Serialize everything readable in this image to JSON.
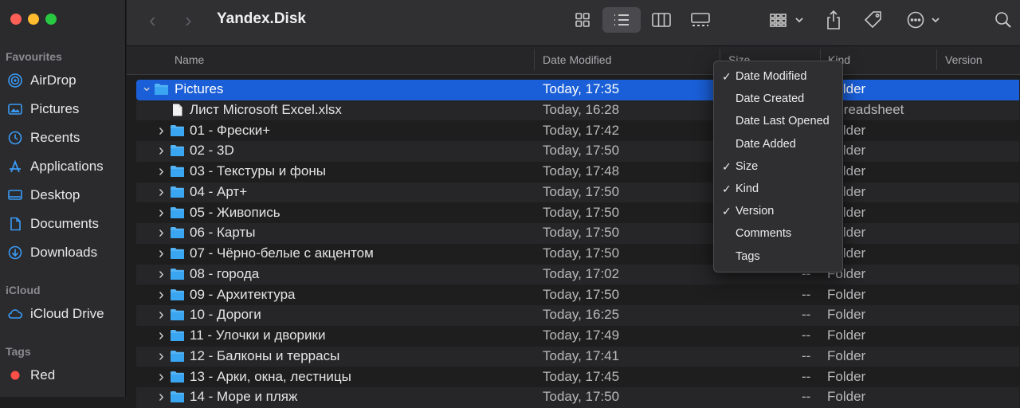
{
  "window": {
    "title": "Yandex.Disk"
  },
  "sidebar": {
    "sections": [
      {
        "label": "Favourites"
      },
      {
        "label": "iCloud"
      },
      {
        "label": "Tags"
      }
    ],
    "favourites": [
      {
        "label": "AirDrop",
        "icon": "airdrop-icon"
      },
      {
        "label": "Pictures",
        "icon": "pictures-icon"
      },
      {
        "label": "Recents",
        "icon": "clock-icon"
      },
      {
        "label": "Applications",
        "icon": "applications-icon"
      },
      {
        "label": "Desktop",
        "icon": "desktop-icon"
      },
      {
        "label": "Documents",
        "icon": "document-icon"
      },
      {
        "label": "Downloads",
        "icon": "download-icon"
      }
    ],
    "icloud": [
      {
        "label": "iCloud Drive",
        "icon": "cloud-icon"
      }
    ],
    "tags": [
      {
        "label": "Red",
        "color": "#ff4f49"
      }
    ]
  },
  "toolbar": {
    "back": "‹",
    "forward": "›"
  },
  "columns": {
    "name": "Name",
    "date_modified": "Date Modified",
    "size": "Size",
    "kind": "Kind",
    "version": "Version"
  },
  "rows": [
    {
      "name": "Pictures",
      "date": "Today, 17:35",
      "size": "",
      "kind": "Folder",
      "type": "folder",
      "expanded": true,
      "selected": true
    },
    {
      "name": "Лист Microsoft Excel.xlsx",
      "date": "Today, 16:28",
      "size": "",
      "kind": "Spreadsheet",
      "type": "file"
    },
    {
      "name": "01 - Фрески+",
      "date": "Today, 17:42",
      "size": "--",
      "kind": "Folder",
      "type": "folder"
    },
    {
      "name": "02 - 3D",
      "date": "Today, 17:50",
      "size": "--",
      "kind": "Folder",
      "type": "folder"
    },
    {
      "name": "03 - Текстуры и фоны",
      "date": "Today, 17:48",
      "size": "--",
      "kind": "Folder",
      "type": "folder"
    },
    {
      "name": "04 - Арт+",
      "date": "Today, 17:50",
      "size": "--",
      "kind": "Folder",
      "type": "folder"
    },
    {
      "name": "05 - Живопись",
      "date": "Today, 17:50",
      "size": "--",
      "kind": "Folder",
      "type": "folder"
    },
    {
      "name": "06 - Карты",
      "date": "Today, 17:50",
      "size": "--",
      "kind": "Folder",
      "type": "folder"
    },
    {
      "name": "07 - Чёрно-белые с акцентом",
      "date": "Today, 17:50",
      "size": "--",
      "kind": "Folder",
      "type": "folder"
    },
    {
      "name": "08 - города",
      "date": "Today, 17:02",
      "size": "--",
      "kind": "Folder",
      "type": "folder"
    },
    {
      "name": "09 - Архитектура",
      "date": "Today, 17:50",
      "size": "--",
      "kind": "Folder",
      "type": "folder"
    },
    {
      "name": "10 - Дороги",
      "date": "Today, 16:25",
      "size": "--",
      "kind": "Folder",
      "type": "folder"
    },
    {
      "name": "11 - Улочки и дворики",
      "date": "Today, 17:49",
      "size": "--",
      "kind": "Folder",
      "type": "folder"
    },
    {
      "name": "12 - Балконы и террасы",
      "date": "Today, 17:41",
      "size": "--",
      "kind": "Folder",
      "type": "folder"
    },
    {
      "name": "13 - Арки, окна, лестницы",
      "date": "Today, 17:45",
      "size": "--",
      "kind": "Folder",
      "type": "folder"
    },
    {
      "name": "14 - Море и пляж",
      "date": "Today, 17:50",
      "size": "--",
      "kind": "Folder",
      "type": "folder"
    }
  ],
  "column_menu": [
    {
      "label": "Date Modified",
      "checked": true
    },
    {
      "label": "Date Created",
      "checked": false
    },
    {
      "label": "Date Last Opened",
      "checked": false
    },
    {
      "label": "Date Added",
      "checked": false
    },
    {
      "label": "Size",
      "checked": true
    },
    {
      "label": "Kind",
      "checked": true
    },
    {
      "label": "Version",
      "checked": true
    },
    {
      "label": "Comments",
      "checked": false
    },
    {
      "label": "Tags",
      "checked": false
    }
  ],
  "colors": {
    "selection": "#1a5fd8",
    "folder": "#3aa5f0",
    "accent": "#2d8cf0"
  }
}
